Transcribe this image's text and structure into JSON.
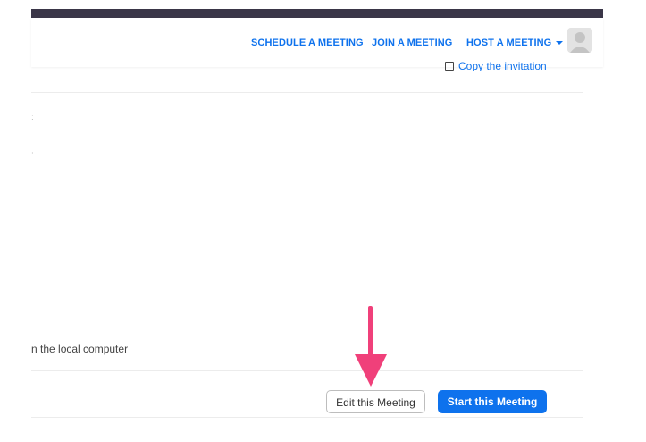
{
  "nav": {
    "schedule": "SCHEDULE A MEETING",
    "join": "JOIN A MEETING",
    "host": "HOST A MEETING"
  },
  "meeting": {
    "copy_invitation": "Copy the invitation",
    "local_computer_text": "n the local computer"
  },
  "actions": {
    "edit": "Edit this Meeting",
    "start": "Start this Meeting"
  },
  "colors": {
    "brand_blue": "#0e72ed",
    "annotation_arrow": "#f0407a",
    "topbar": "#3a3648"
  },
  "icons": {
    "avatar": "user-avatar-icon",
    "annotation": "arrow-down-icon"
  }
}
